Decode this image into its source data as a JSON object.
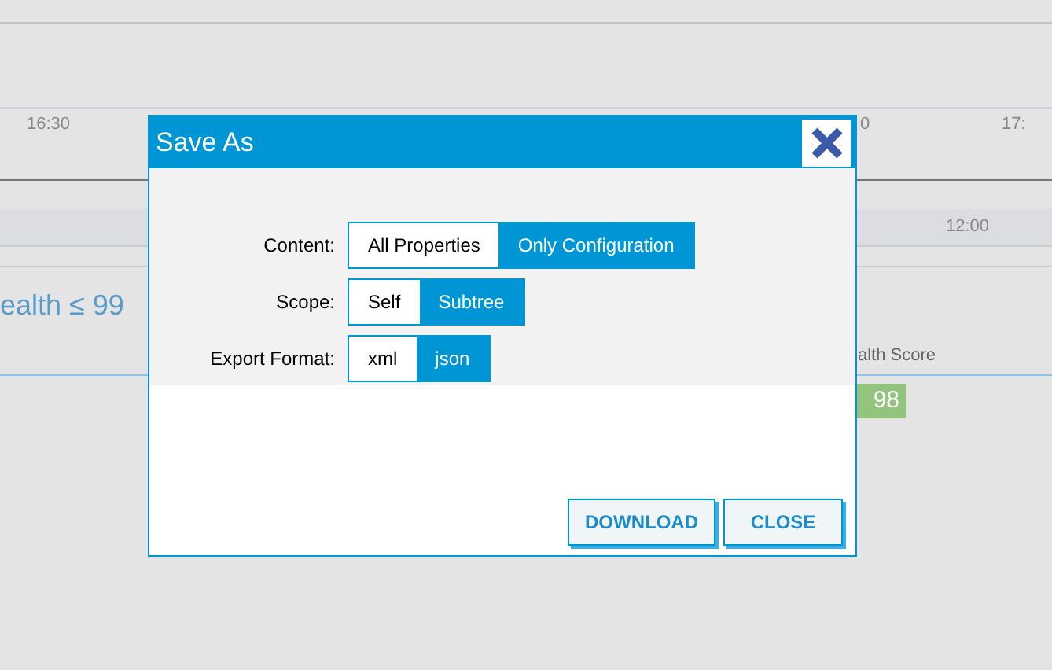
{
  "background": {
    "time_labels": [
      "16:30",
      "0",
      "17:"
    ],
    "band_time": "12:00",
    "filter_title": "ealth ≤ 99",
    "column_header": "alth Score",
    "score_badge": "98"
  },
  "dialog": {
    "title": "Save As",
    "options": [
      {
        "label": "Content:",
        "choices": [
          {
            "label": "All Properties",
            "selected": false
          },
          {
            "label": "Only Configuration",
            "selected": true
          }
        ]
      },
      {
        "label": "Scope:",
        "choices": [
          {
            "label": "Self",
            "selected": false
          },
          {
            "label": "Subtree",
            "selected": true
          }
        ]
      },
      {
        "label": "Export Format:",
        "choices": [
          {
            "label": "xml",
            "selected": false
          },
          {
            "label": "json",
            "selected": true
          }
        ]
      }
    ],
    "buttons": [
      "DOWNLOAD",
      "CLOSE"
    ]
  }
}
